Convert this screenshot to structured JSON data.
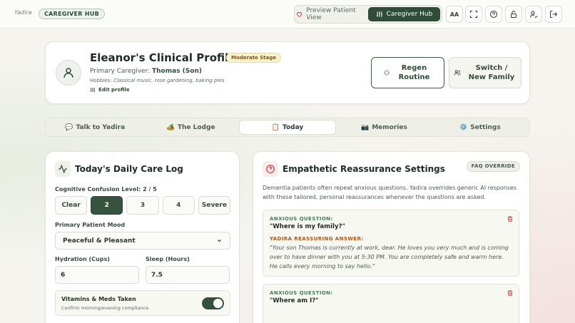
{
  "topbar": {
    "logo": "Yadira",
    "hub_badge": "CAREGIVER HUB",
    "preview_label": "Preview Patient View",
    "hub_label": "Caregiver Hub",
    "text_size_label": "AA",
    "icons": [
      "fullscreen-icon",
      "help-icon",
      "lock-icon",
      "user-settings-icon",
      "logout-icon"
    ]
  },
  "profile": {
    "title": "Eleanor's Clinical Profile",
    "stage": "Moderate Stage",
    "caregiver_prefix": "Primary Caregiver:",
    "caregiver_name": "Thomas (Son)",
    "hobbies_prefix": "Hobbies:",
    "hobbies": "Classical music, rose gardening, baking pies",
    "edit_label": "Edit profile",
    "regen_label": "Regen Routine",
    "switch_label": "Switch / New Family"
  },
  "tabs": [
    {
      "icon": "💬",
      "label": "Talk to Yadira"
    },
    {
      "icon": "🏕️",
      "label": "The Lodge"
    },
    {
      "icon": "📋",
      "label": "Today"
    },
    {
      "icon": "📷",
      "label": "Memories"
    },
    {
      "icon": "⚙️",
      "label": "Settings"
    }
  ],
  "log": {
    "title": "Today's Daily Care Log",
    "confusion_label": "Cognitive Confusion Level: 2 / 5",
    "confusion_options": [
      "Clear",
      "2",
      "3",
      "4",
      "Severe"
    ],
    "mood_label": "Primary Patient Mood",
    "mood_value": "Peaceful & Pleasant",
    "hydration_label": "Hydration (Cups)",
    "hydration_value": "6",
    "sleep_label": "Sleep (Hours)",
    "sleep_value": "7.5",
    "vitamins_title": "Vitamins & Meds Taken",
    "vitamins_sub": "Confirm morning/evening compliance"
  },
  "settings": {
    "title": "Empathetic Reassurance Settings",
    "badge": "FAQ OVERRIDE",
    "description": "Dementia patients often repeat anxious questions. Yadira overrides generic AI responses with these tailored, personal reassurances whenever the questions are asked.",
    "question_label": "ANXIOUS QUESTION:",
    "answer_label": "YADIRA REASSURING ANSWER:",
    "faqs": [
      {
        "question": "\"Where is my family?\"",
        "answer": "\"Your son Thomas is currently at work, dear. He loves you very much and is coming over to have dinner with you at 5:30 PM. You are completely safe and warm here. He calls every morning to say hello.\""
      },
      {
        "question": "\"Where am I?\""
      }
    ]
  },
  "colors": {
    "accent": "#2f4b3a",
    "stage_badge_bg": "#fbf1d3",
    "answer_label": "#b05a14"
  }
}
